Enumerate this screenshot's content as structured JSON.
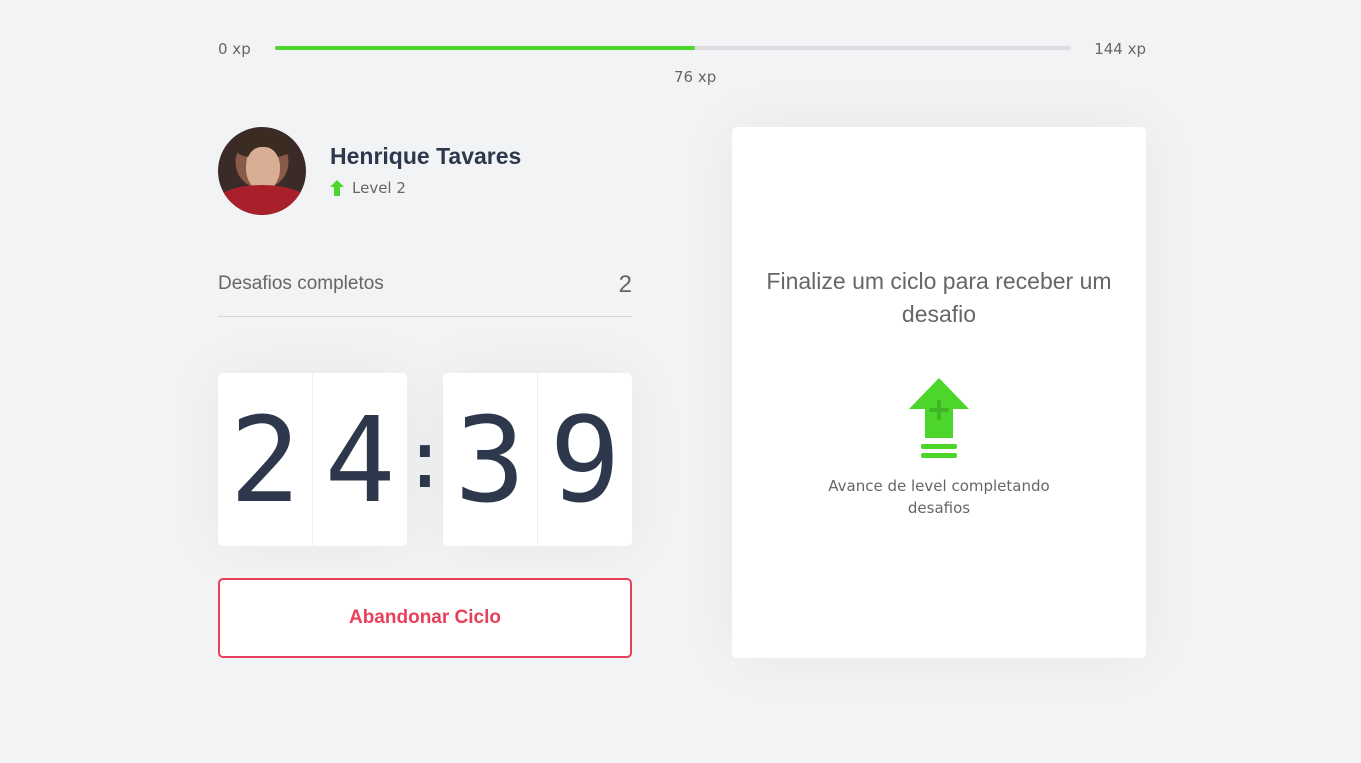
{
  "xp": {
    "min_label": "0 xp",
    "max_label": "144 xp",
    "current_label": "76 xp",
    "current": 76,
    "max": 144,
    "fill_color": "#4cd62b"
  },
  "profile": {
    "name": "Henrique Tavares",
    "level_label": "Level 2",
    "level_icon": "level-up-icon"
  },
  "challenges": {
    "label": "Desafios completos",
    "count": "2"
  },
  "countdown": {
    "minute_tens": "2",
    "minute_ones": "4",
    "separator": ":",
    "second_tens": "3",
    "second_ones": "9"
  },
  "actions": {
    "abandon_label": "Abandonar Ciclo",
    "abandon_color": "#e83f5b"
  },
  "challenge_box": {
    "title": "Finalize um ciclo para receber um desafio",
    "icon": "level-up-icon",
    "description": "Avance de level completando desafios"
  }
}
